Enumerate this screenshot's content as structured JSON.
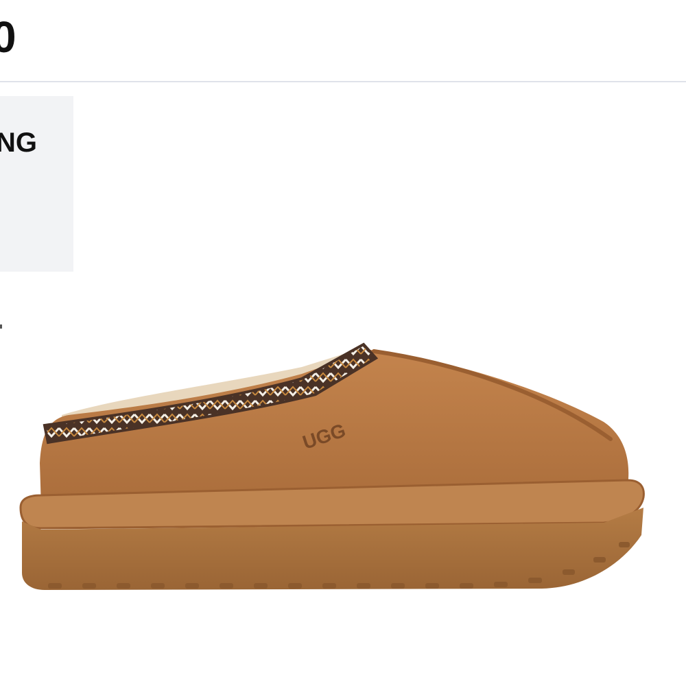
{
  "header": {
    "value_fragment": "0"
  },
  "info_card": {
    "text_fragment": "NG"
  },
  "product": {
    "logo_text": "UGG",
    "image_icon": "slipper-product-image",
    "colors": {
      "suede": "#b97a45",
      "suede_shadow": "#9a5f31",
      "sole": "#a8733f",
      "braid_dark": "#4a3226",
      "braid_light": "#f4efe6",
      "braid_orange": "#c98a3f",
      "fleece": "#e8d7bd"
    }
  }
}
